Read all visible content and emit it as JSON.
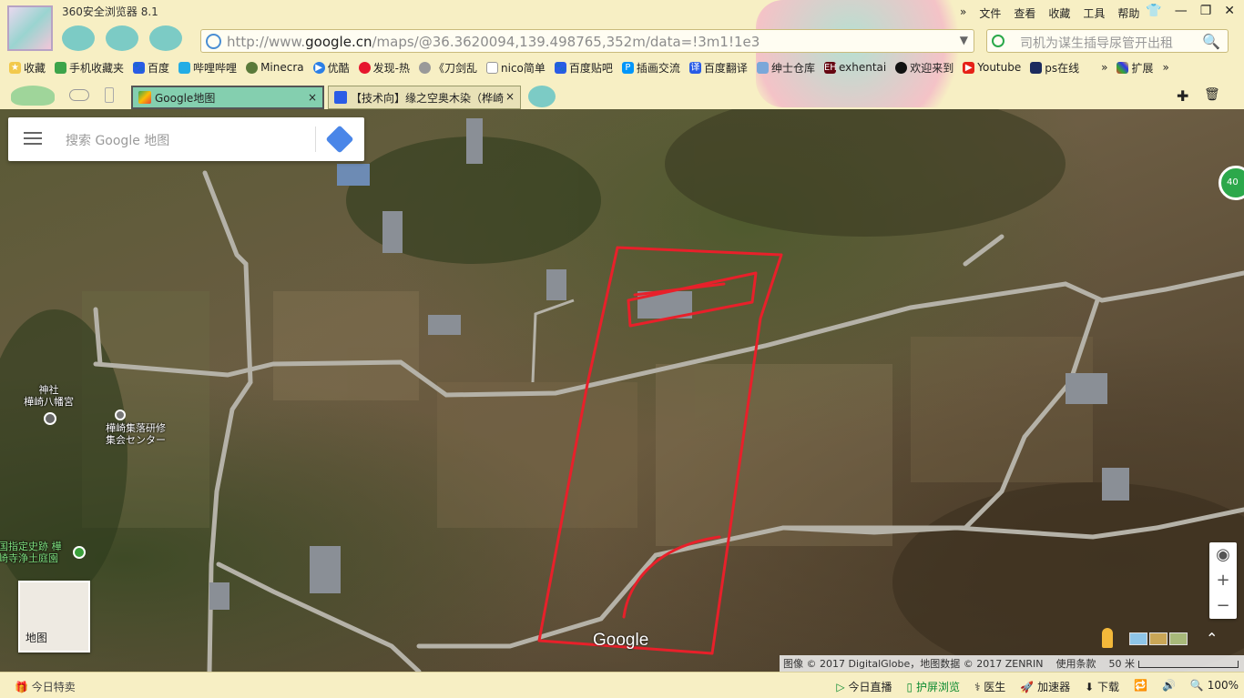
{
  "window": {
    "app_title": "360安全浏览器 8.1",
    "menu": [
      "文件",
      "查看",
      "收藏",
      "工具",
      "帮助"
    ],
    "controls": [
      "skin-icon",
      "minimize-icon",
      "maximize-icon",
      "close-icon"
    ]
  },
  "address_bar": {
    "url_prefix": "http://www.",
    "url_domain": "google.cn",
    "url_rest": "/maps/@36.3620094,139.498765,352m/data=!3m1!1e3",
    "dropdown": "▼"
  },
  "search_bar": {
    "placeholder": "司机为谋生插导尿管开出租",
    "button": "🔍"
  },
  "bookmarks": [
    {
      "label": "收藏",
      "icon": "star-icon"
    },
    {
      "label": "手机收藏夹",
      "icon": "phone-icon"
    },
    {
      "label": "百度",
      "icon": "baidu-icon"
    },
    {
      "label": "哔哩哔哩",
      "icon": "bilibili-icon"
    },
    {
      "label": "Minecra",
      "icon": "minecraft-icon"
    },
    {
      "label": "优酷",
      "icon": "youku-icon"
    },
    {
      "label": "发现-热",
      "icon": "weibo-icon"
    },
    {
      "label": "《刀剑乱",
      "icon": "swirl-icon"
    },
    {
      "label": "nico简单",
      "icon": "page-icon"
    },
    {
      "label": "百度贴吧",
      "icon": "baidu-icon"
    },
    {
      "label": "插画交流",
      "icon": "pixiv-icon"
    },
    {
      "label": "百度翻译",
      "icon": "translate-icon"
    },
    {
      "label": "绅士仓库",
      "icon": "box-icon"
    },
    {
      "label": "exhentai",
      "icon": "eh-icon"
    },
    {
      "label": "欢迎来到",
      "icon": "steam-icon"
    },
    {
      "label": "Youtube",
      "icon": "youtube-icon"
    },
    {
      "label": "ps在线",
      "icon": "ps-icon"
    },
    {
      "label": "扩展",
      "icon": "extension-icon"
    }
  ],
  "bookmarks_more": "»",
  "tabs": [
    {
      "label": "Google地图",
      "active": true
    },
    {
      "label": "【技术向】缘之空奥木染（桦崎",
      "active": false
    }
  ],
  "tab_close": "×",
  "tab_tools": [
    "new-tab-icon",
    "trash-icon"
  ],
  "map": {
    "search_placeholder": "搜索 Google 地图",
    "labels": {
      "shrine_type": "神社",
      "shrine_name": "樺崎八幡宮",
      "center_name_1": "樺崎集落研修",
      "center_name_2": "集会センター",
      "historic_1": "国指定史跡 樺",
      "historic_2": "崎寺浄土庭園"
    },
    "minimap_label": "地图",
    "badge": "40",
    "google_logo": "Google",
    "zoom_in": "+",
    "zoom_out": "−",
    "expand": "⌃",
    "attribution": "图像 © 2017 DigitalGlobe，地图数据 © 2017 ZENRIN",
    "terms": "使用条款",
    "scale": "50 米",
    "accent_red": "#e8202a"
  },
  "statusbar": {
    "left": "今日特卖",
    "items": [
      {
        "label": "今日直播",
        "icon": "play-icon"
      },
      {
        "label": "护屏浏览",
        "icon": "screen-icon"
      },
      {
        "label": "医生",
        "icon": "doctor-icon"
      },
      {
        "label": "加速器",
        "icon": "rocket-icon"
      },
      {
        "label": "下载",
        "icon": "download-icon"
      },
      {
        "label": "",
        "icon": "compat-icon"
      },
      {
        "label": "",
        "icon": "sound-icon"
      },
      {
        "label": "100%",
        "icon": "zoom-icon"
      }
    ]
  }
}
